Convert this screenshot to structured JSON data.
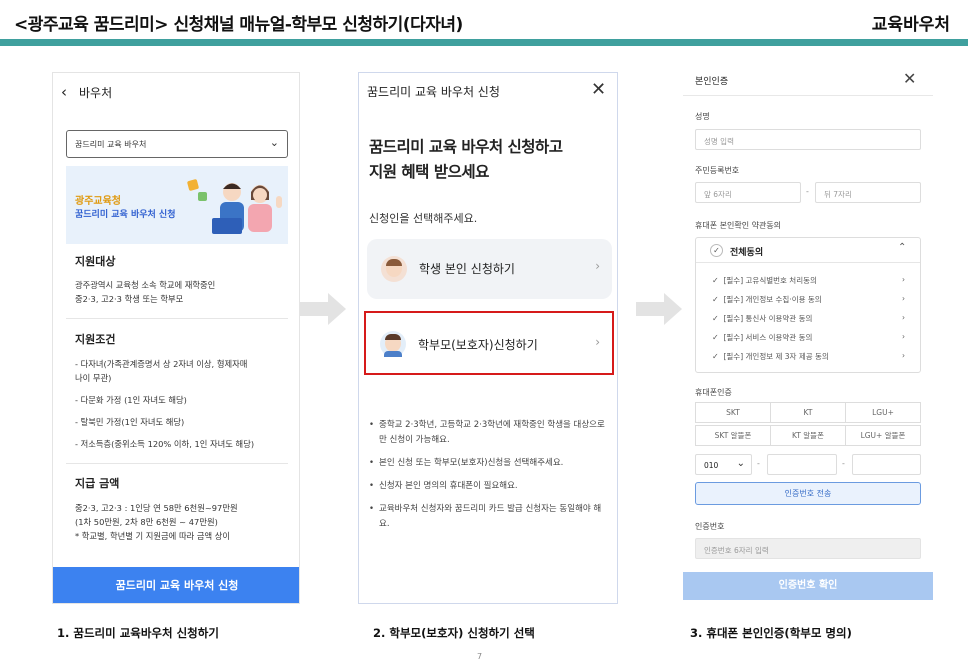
{
  "header": {
    "title": "<광주교육 꿈드리미> 신청채널 매뉴얼-학부모 신청하기(다자녀)",
    "right_label": "교육바우처",
    "accent_color": "#3fa09e"
  },
  "panel1": {
    "back_label": "바우처",
    "select_value": "꿈드리미 교육 바우처",
    "banner_line1": "광주교육청",
    "banner_line2": "꿈드리미 교육 바우처 신청",
    "sections": [
      {
        "heading": "지원대상",
        "lines": [
          "광주광역시 교육청 소속 학교에 재학중인",
          "중2·3, 고2·3 학생 또는 학부모"
        ]
      },
      {
        "heading": "지원조건",
        "lines": [
          "- 다자녀(가족관계증명서 상 2자녀 이상, 형제자매",
          "   나이 무관)",
          "- 다문화 가정 (1인 자녀도 해당)",
          "- 탈북민 가정(1인 자녀도 해당)",
          "- 저소득층(중위소득 120% 이하, 1인 자녀도 해당)"
        ]
      },
      {
        "heading": "지급 금액",
        "lines": [
          "중2·3, 고2·3 : 1인당 연 58만 6천원~97만원",
          "(1차 50만원, 2차 8만 6천원 ~ 47만원)",
          "* 학교별, 학년별 기 지원금에 따라 금액 상이"
        ]
      }
    ],
    "apply_button": "꿈드리미 교육 바우처 신청",
    "button_color": "#3c82f0"
  },
  "panel2": {
    "title": "꿈드리미 교육 바우처 신청",
    "headline_1": "꿈드리미 교육 바우처 신청하고",
    "headline_2": "지원 혜택 받으세요",
    "subtext": "신청인을 선택해주세요.",
    "options": [
      {
        "label": "학생 본인 신청하기"
      },
      {
        "label": "학부모(보호자)신청하기"
      }
    ],
    "notes": [
      "중학교 2·3학년, 고등학교 2·3학년에 재학중인 학생을 대상으로만 신청이 가능해요.",
      "본인 신청 또는 학부모(보호자)신청을 선택해주세요.",
      "신청자 본인 명의의 휴대폰이 필요해요.",
      "교육바우처 신청자와 꿈드리미 카드 발급 신청자는 동일해야 해요."
    ],
    "highlight_color": "#d61a1a"
  },
  "panel3": {
    "title": "본인인증",
    "name_label": "성명",
    "name_placeholder": "성명 입력",
    "rrn_label": "주민등록번호",
    "rrn_front_placeholder": "앞 6자리",
    "rrn_dash": "-",
    "rrn_back_placeholder": "뒤 7자리",
    "agree_label": "휴대폰 본인확인 약관동의",
    "agree_all": "전체동의",
    "agree_items": [
      "[필수] 고유식별번호 처리동의",
      "[필수] 개인정보 수집·이용 동의",
      "[필수] 통신사 이용약관 동의",
      "[필수] 서비스 이용약관 동의",
      "[필수] 개인정보 제 3자 제공 동의"
    ],
    "phone_label": "휴대폰인증",
    "carriers": [
      "SKT",
      "KT",
      "LGU+",
      "SKT 알뜰폰",
      "KT 알뜰폰",
      "LGU+ 알뜰폰"
    ],
    "area_code": "010",
    "send_button": "인증번호 전송",
    "code_label": "인증번호",
    "code_placeholder": "인증번호 6자리 입력",
    "confirm_button": "인증번호 확인"
  },
  "captions": [
    "1. 꿈드리미 교육바우처 신청하기",
    "2. 학부모(보호자) 신청하기 선택",
    "3. 휴대폰 본인인증(학부모 명의)"
  ],
  "page_number": "7"
}
